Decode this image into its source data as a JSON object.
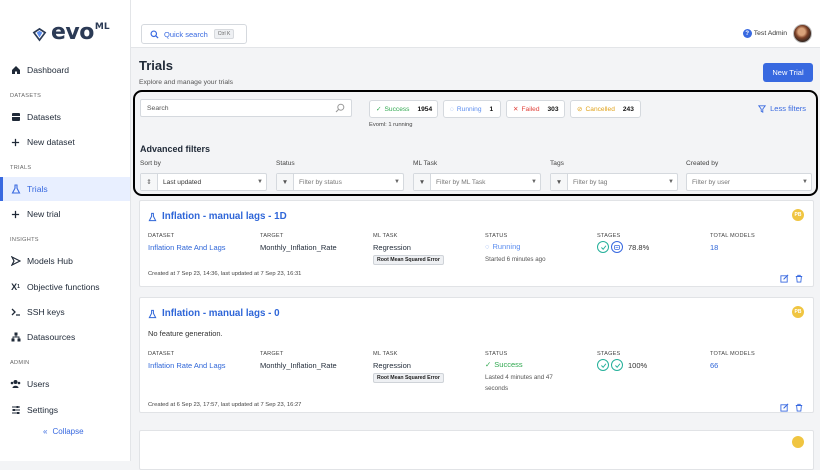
{
  "brand": {
    "name": "evo",
    "superscript": "ML"
  },
  "nav": {
    "dashboard": "Dashboard",
    "section_datasets": "DATASETS",
    "datasets": "Datasets",
    "new_dataset": "New dataset",
    "section_trials": "TRIALS",
    "trials": "Trials",
    "new_trial": "New trial",
    "section_insights": "INSIGHTS",
    "models_hub": "Models Hub",
    "objective_functions": "Objective functions",
    "ssh_keys": "SSH keys",
    "datasources": "Datasources",
    "section_admin": "ADMIN",
    "users": "Users",
    "settings": "Settings",
    "collapse": "Collapse"
  },
  "topbar": {
    "quick_search": "Quick search",
    "shortcut": "Ctrl K",
    "user_name": "Test Admin"
  },
  "page": {
    "title": "Trials",
    "subtitle": "Explore and manage your trials",
    "new_trial_button": "New Trial"
  },
  "filters": {
    "search_placeholder": "Search",
    "chips": [
      {
        "label": "Success",
        "count": "1954",
        "color": "#2fa84f"
      },
      {
        "label": "Running",
        "count": "1",
        "color": "#5b8def"
      },
      {
        "label": "Failed",
        "count": "303",
        "color": "#e0413a"
      },
      {
        "label": "Cancelled",
        "count": "243",
        "color": "#e0a21a"
      }
    ],
    "running_note": "Evoml: 1 running",
    "less_filters": "Less filters",
    "advanced_title": "Advanced filters",
    "sort_by_label": "Sort by",
    "sort_by_value": "Last updated",
    "status_label": "Status",
    "status_placeholder": "Filter by status",
    "ml_task_label": "ML Task",
    "ml_task_placeholder": "Filter by ML Task",
    "tags_label": "Tags",
    "tags_placeholder": "Filter by tag",
    "created_by_label": "Created by",
    "created_by_placeholder": "Filter by user"
  },
  "columns": {
    "dataset": "DATASET",
    "target": "TARGET",
    "ml_task": "ML TASK",
    "status": "STATUS",
    "stages": "STAGES",
    "total_models": "TOTAL MODELS"
  },
  "trials": [
    {
      "title": "Inflation - manual lags - 1D",
      "owner_initials": "PB",
      "dataset": "Inflation Rate And Lags",
      "target": "Monthly_Inflation_Rate",
      "ml_task": "Regression",
      "metric": "Root Mean Squared Error",
      "status": "Running",
      "status_color": "#5b8def",
      "status_detail": "Started 6 minutes ago",
      "stage_progress": "78.8%",
      "total_models": "18",
      "created": "Created at 7 Sep 23, 14:36, last updated at 7 Sep 23, 16:31"
    },
    {
      "title": "Inflation - manual lags - 0",
      "owner_initials": "PB",
      "note": "No feature generation.",
      "dataset": "Inflation Rate And Lags",
      "target": "Monthly_Inflation_Rate",
      "ml_task": "Regression",
      "metric": "Root Mean Squared Error",
      "status": "Success",
      "status_color": "#2fa84f",
      "status_detail_line1": "Lasted 4 minutes and 47",
      "status_detail_line2": "seconds",
      "stage_progress": "100%",
      "total_models": "66",
      "created": "Created at 6 Sep 23, 17:57, last updated at 7 Sep 23, 16:27"
    }
  ]
}
